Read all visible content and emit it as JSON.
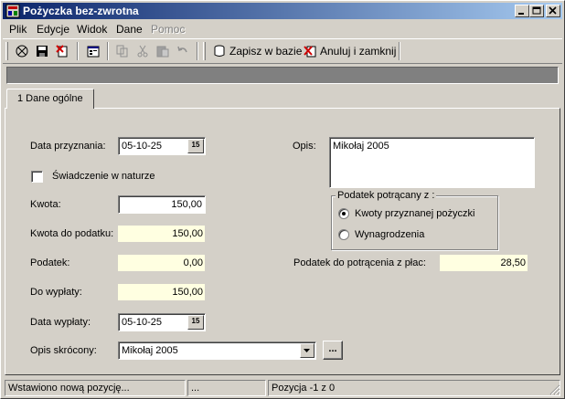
{
  "window": {
    "title": "Pożyczka bez-zwrotna"
  },
  "menu": {
    "items": [
      {
        "label": "Plik",
        "disabled": false
      },
      {
        "label": "Edycje",
        "disabled": false
      },
      {
        "label": "Widok",
        "disabled": false
      },
      {
        "label": "Dane",
        "disabled": false
      },
      {
        "label": "Pomoc",
        "disabled": true
      }
    ]
  },
  "toolbar": {
    "save_to_db_label": "Zapisz w bazie",
    "cancel_close_label": "Anuluj i zamknij"
  },
  "tabs": [
    {
      "label": "1 Dane ogólne",
      "active": true
    }
  ],
  "form": {
    "grant_date": {
      "label": "Data przyznania:",
      "value": "05-10-25"
    },
    "benefit_in_kind": {
      "label": "Świadczenie w naturze",
      "checked": false
    },
    "amount": {
      "label": "Kwota:",
      "value": "150,00"
    },
    "taxable_amount": {
      "label": "Kwota do podatku:",
      "value": "150,00"
    },
    "tax": {
      "label": "Podatek:",
      "value": "0,00"
    },
    "payout": {
      "label": "Do wypłaty:",
      "value": "150,00"
    },
    "payout_date": {
      "label": "Data wypłaty:",
      "value": "05-10-25"
    },
    "short_description": {
      "label": "Opis skrócony:",
      "value": "Mikołaj 2005"
    },
    "description": {
      "label": "Opis:",
      "value": "Mikołaj 2005"
    },
    "tax_from": {
      "title": "Podatek potrącany z :",
      "options": [
        {
          "label": "Kwoty przyznanej pożyczki",
          "checked": true
        },
        {
          "label": "Wynagrodzenia",
          "checked": false
        }
      ]
    },
    "tax_from_salary": {
      "label": "Podatek do potrącenia z płac:",
      "value": "28,50"
    }
  },
  "status": {
    "message": "Wstawiono nową pozycję...",
    "middle": "...",
    "position": "Pozycja -1 z 0"
  },
  "colors": {
    "titlebar_start": "#0a246a",
    "titlebar_end": "#a6caf0",
    "readonly_field": "#ffffe1",
    "face": "#d4d0c8"
  }
}
